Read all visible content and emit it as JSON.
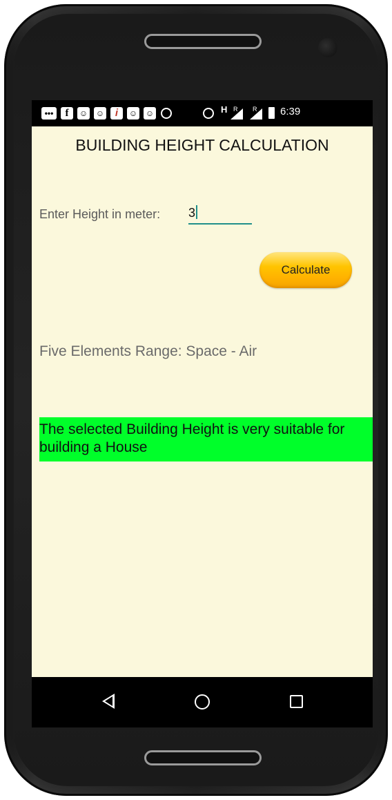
{
  "status_bar": {
    "time": "6:39",
    "network_label": "H",
    "roaming_1": "R",
    "roaming_2": "R",
    "notification_icons": [
      "message-icon",
      "facebook-icon",
      "app-icon",
      "app-icon",
      "red-app-icon",
      "app-icon",
      "app-icon",
      "messenger-icon"
    ]
  },
  "app": {
    "title": "BUILDING HEIGHT CALCULATION",
    "height_label": "Enter Height in meter:",
    "height_value": "3",
    "calculate_label": "Calculate",
    "range_text": "Five Elements Range: Space - Air",
    "result_text": "The selected Building Height is very suitable for building a House",
    "result_color": "#00ff2a",
    "button_color": "#ffc400",
    "background_color": "#fbf8dc"
  },
  "nav": {
    "back_icon": "back-triangle-icon",
    "home_icon": "home-circle-icon",
    "recent_icon": "recent-apps-square-icon"
  }
}
